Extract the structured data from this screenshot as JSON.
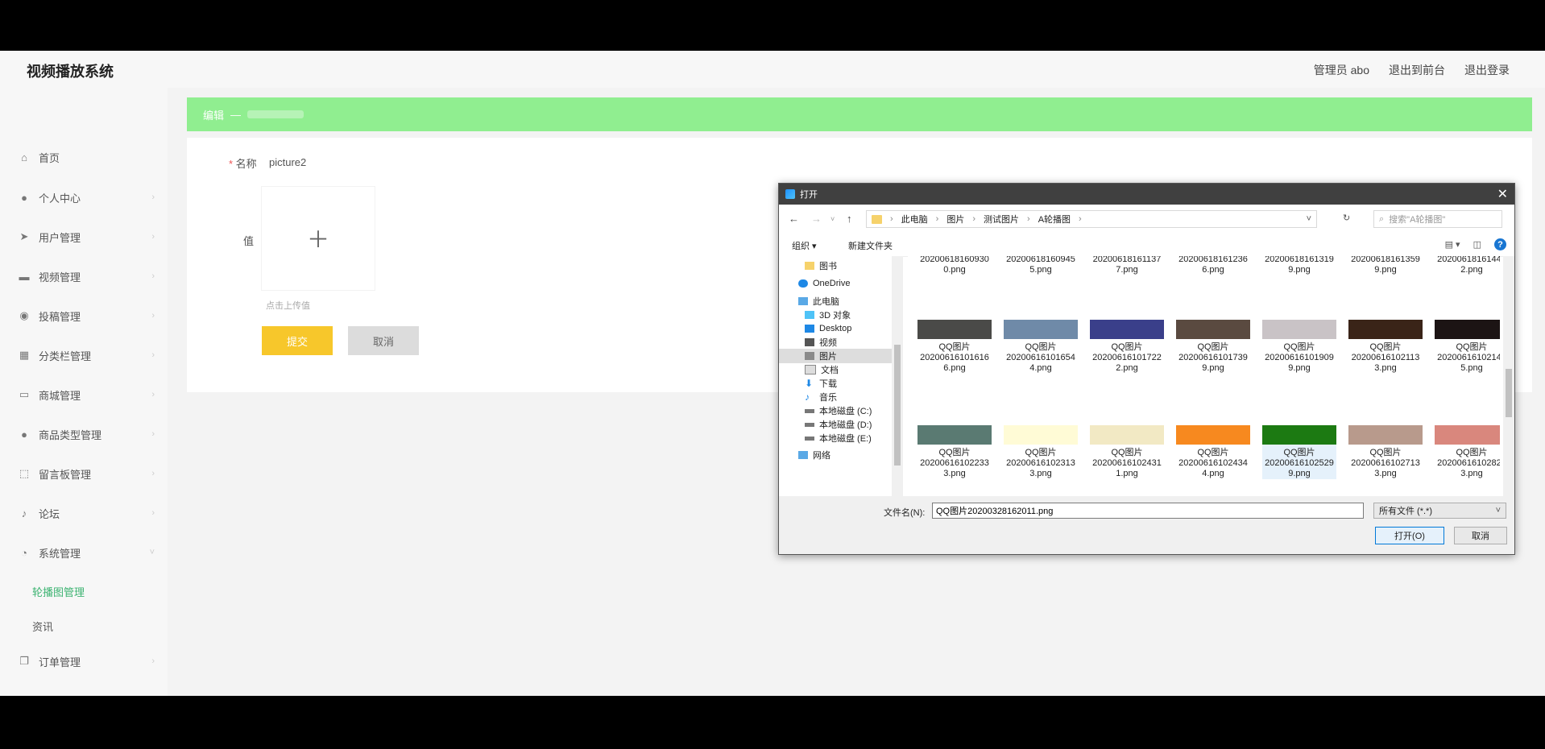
{
  "header": {
    "brand": "视频播放系统",
    "links": [
      "管理员 abo",
      "退出到前台",
      "退出登录"
    ]
  },
  "sidebar": {
    "items": [
      {
        "label": "首页",
        "icon": "home-icon"
      },
      {
        "label": "个人中心",
        "icon": "user-icon"
      },
      {
        "label": "用户管理",
        "icon": "send-icon"
      },
      {
        "label": "视频管理",
        "icon": "monitor-icon"
      },
      {
        "label": "投稿管理",
        "icon": "disc-icon"
      },
      {
        "label": "分类栏管理",
        "icon": "grid-icon"
      },
      {
        "label": "商城管理",
        "icon": "screen-icon"
      },
      {
        "label": "商品类型管理",
        "icon": "person-icon"
      },
      {
        "label": "留言板管理",
        "icon": "frame-icon"
      },
      {
        "label": "论坛",
        "icon": "mic-icon"
      },
      {
        "label": "系统管理",
        "icon": "clock-icon"
      }
    ],
    "sub_items": [
      "轮播图管理",
      "资讯"
    ],
    "last_item": {
      "label": "订单管理",
      "icon": "copy-icon"
    }
  },
  "breadcrumb": {
    "first": "编辑",
    "sep": "—"
  },
  "form": {
    "name_label": "名称",
    "name_value": "picture2",
    "value_label": "值",
    "upload_hint": "点击上传值",
    "submit_label": "提交",
    "cancel_label": "取消"
  },
  "dialog": {
    "title": "打开",
    "path": [
      "此电脑",
      "图片",
      "测试图片",
      "A轮播图"
    ],
    "search_placeholder": "搜索\"A轮播图\"",
    "toolbar": {
      "organize": "组织 ▾",
      "new_folder": "新建文件夹"
    },
    "tree": [
      {
        "label": "图书",
        "icon": "folder-icon"
      },
      {
        "label": "OneDrive",
        "icon": "cloud-icon"
      },
      {
        "label": "此电脑",
        "icon": "computer-icon"
      },
      {
        "label": "3D 对象",
        "icon": "cube-icon"
      },
      {
        "label": "Desktop",
        "icon": "desktop-icon"
      },
      {
        "label": "视频",
        "icon": "video-icon"
      },
      {
        "label": "图片",
        "icon": "picture-icon"
      },
      {
        "label": "文档",
        "icon": "document-icon"
      },
      {
        "label": "下载",
        "icon": "download-icon"
      },
      {
        "label": "音乐",
        "icon": "music-icon"
      },
      {
        "label": "本地磁盘 (C:)",
        "icon": "drive-icon"
      },
      {
        "label": "本地磁盘 (D:)",
        "icon": "drive-icon"
      },
      {
        "label": "本地磁盘 (E:)",
        "icon": "drive-icon"
      },
      {
        "label": "网络",
        "icon": "network-icon"
      }
    ],
    "files_row1": [
      {
        "l1": "20200618160930",
        "l2": "0.png"
      },
      {
        "l1": "20200618160945",
        "l2": "5.png"
      },
      {
        "l1": "20200618161137",
        "l2": "7.png"
      },
      {
        "l1": "20200618161236",
        "l2": "6.png"
      },
      {
        "l1": "20200618161319",
        "l2": "9.png"
      },
      {
        "l1": "20200618161359",
        "l2": "9.png"
      },
      {
        "l1": "20200618161442",
        "l2": "2.png"
      }
    ],
    "files_row2": [
      {
        "l1": "QQ图片",
        "l2": "20200616101616",
        "l3": "6.png",
        "color": "#4a4a48"
      },
      {
        "l1": "QQ图片",
        "l2": "20200616101654",
        "l3": "4.png",
        "color": "#6f8aa8"
      },
      {
        "l1": "QQ图片",
        "l2": "20200616101722",
        "l3": "2.png",
        "color": "#3a3f8a"
      },
      {
        "l1": "QQ图片",
        "l2": "20200616101739",
        "l3": "9.png",
        "color": "#5a4a40"
      },
      {
        "l1": "QQ图片",
        "l2": "20200616101909",
        "l3": "9.png",
        "color": "#c9c3c6"
      },
      {
        "l1": "QQ图片",
        "l2": "20200616102113",
        "l3": "3.png",
        "color": "#3a2418"
      },
      {
        "l1": "QQ图片",
        "l2": "20200616102145",
        "l3": "5.png",
        "color": "#1c1414"
      }
    ],
    "files_row3": [
      {
        "l1": "QQ图片",
        "l2": "20200616102233",
        "l3": "3.png",
        "color": "#5a7a72"
      },
      {
        "l1": "QQ图片",
        "l2": "20200616102313",
        "l3": "3.png",
        "color": "#fffbd6"
      },
      {
        "l1": "QQ图片",
        "l2": "20200616102431",
        "l3": "1.png",
        "color": "#f2e9c4"
      },
      {
        "l1": "QQ图片",
        "l2": "20200616102434",
        "l3": "4.png",
        "color": "#f7891f"
      },
      {
        "l1": "QQ图片",
        "l2": "20200616102529",
        "l3": "9.png",
        "color": "#1c7a12"
      },
      {
        "l1": "QQ图片",
        "l2": "20200616102713",
        "l3": "3.png",
        "color": "#b89a8c"
      },
      {
        "l1": "QQ图片",
        "l2": "20200616102823",
        "l3": "3.png",
        "color": "#d9877d"
      }
    ],
    "filename_label": "文件名(N):",
    "filename_value": "QQ图片20200328162011.png",
    "filetype": "所有文件 (*.*)",
    "open_label": "打开(O)",
    "cancel_label": "取消"
  }
}
